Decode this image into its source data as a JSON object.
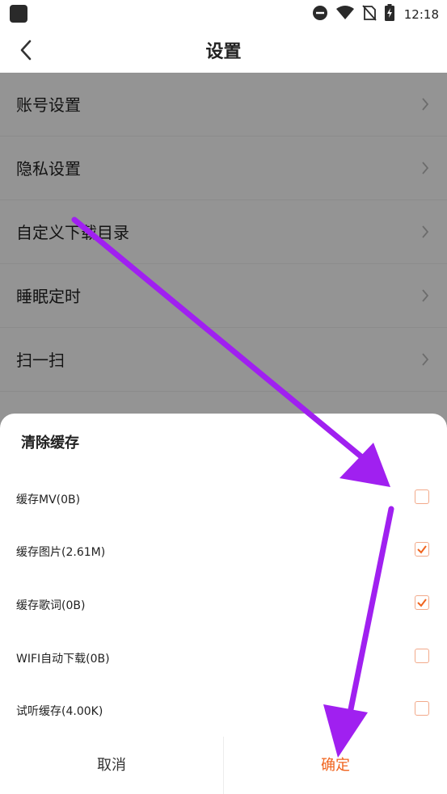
{
  "status_bar": {
    "time": "12:18",
    "icons": [
      "app-icon",
      "do-not-disturb-icon",
      "wifi-icon",
      "no-sim-icon",
      "battery-charging-icon"
    ]
  },
  "header": {
    "title": "设置",
    "back_icon": "chevron-left-icon"
  },
  "settings_items": [
    {
      "label": "账号设置"
    },
    {
      "label": "隐私设置"
    },
    {
      "label": "自定义下载目录"
    },
    {
      "label": "睡眠定时"
    },
    {
      "label": "扫一扫"
    }
  ],
  "dialog": {
    "title": "清除缓存",
    "options": [
      {
        "label": "缓存MV(0B)",
        "checked": false
      },
      {
        "label": "缓存图片(2.61M)",
        "checked": true
      },
      {
        "label": "缓存歌词(0B)",
        "checked": true
      },
      {
        "label": "WIFI自动下载(0B)",
        "checked": false
      },
      {
        "label": "试听缓存(4.00K)",
        "checked": false
      }
    ],
    "cancel_label": "取消",
    "confirm_label": "确定"
  },
  "colors": {
    "accent": "#f0641e",
    "checkbox_border": "#f2a98a",
    "annotation_arrow": "#a020f0"
  }
}
